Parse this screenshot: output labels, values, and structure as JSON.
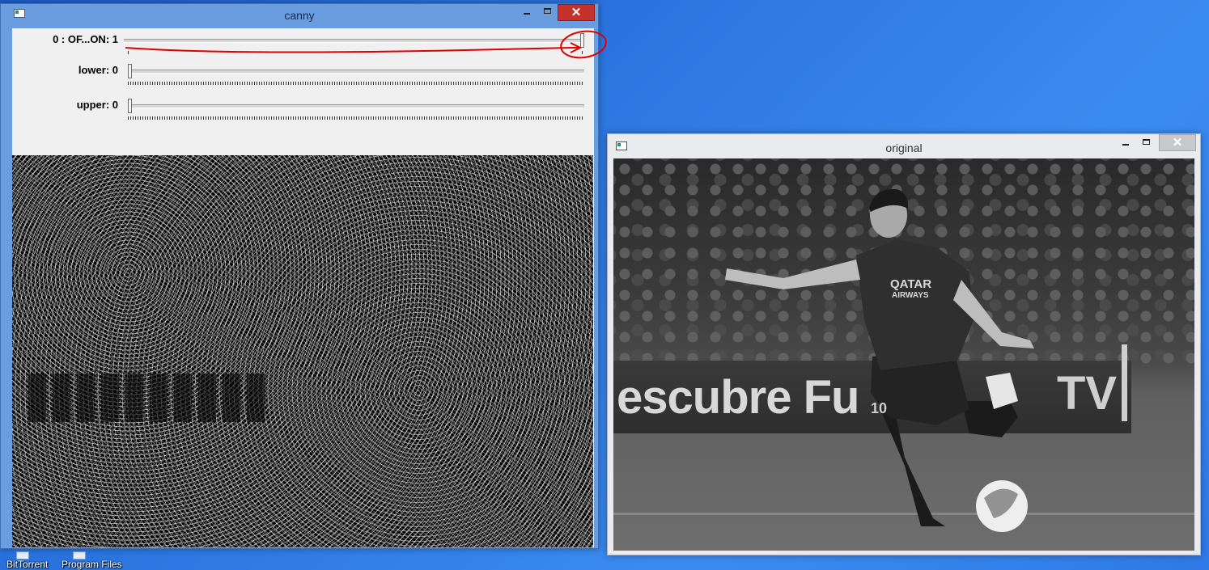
{
  "desktop": {
    "icons": [
      {
        "label": "BitTorrent"
      },
      {
        "label": "Program Files"
      }
    ]
  },
  "canny_window": {
    "title": "canny",
    "state": "active",
    "trackbars": [
      {
        "label": "0 : OF...ON: 1",
        "value": 1,
        "max": 1
      },
      {
        "label": "lower: 0",
        "value": 0,
        "max": 255
      },
      {
        "label": "upper: 0",
        "value": 0,
        "max": 255
      }
    ],
    "annotation_color": "#e00000",
    "image_content": "Canny edge detection output"
  },
  "original_window": {
    "title": "original",
    "state": "inactive",
    "banner_text": "escubre Fu",
    "banner_text_right": "TV",
    "shirt_text_top": "QATAR",
    "shirt_text_bottom": "AIRWAYS",
    "shorts_number": "10"
  },
  "colors": {
    "desktop_blue": "#2a73de",
    "active_frame": "#6a9de0",
    "close_button": "#c7312b"
  }
}
